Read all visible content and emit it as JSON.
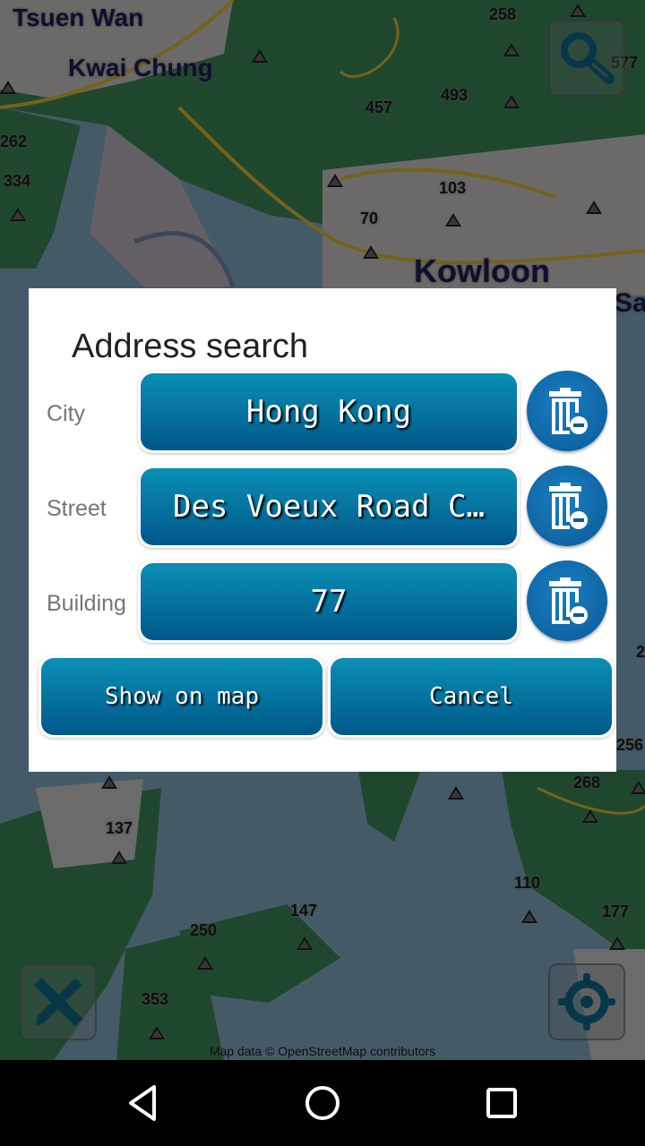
{
  "map": {
    "place_labels": [
      {
        "text": "Tsuen Wan",
        "id": "tsuen-wan"
      },
      {
        "text": "Kwai Chung",
        "id": "kwai-chung"
      },
      {
        "text": "Kowloon",
        "id": "kowloon"
      },
      {
        "text": "Sa",
        "id": "sa-partial"
      }
    ],
    "elevation_labels": [
      "258",
      "493",
      "457",
      "577",
      "262",
      "334",
      "103",
      "70",
      "137",
      "147",
      "250",
      "353",
      "268",
      "110",
      "177",
      "256",
      "2"
    ],
    "attribution": "Map data © OpenStreetMap contributors",
    "buttons": {
      "search": {
        "icon": "magnifier-icon"
      },
      "measure": {
        "icon": "ruler-pencil-icon"
      },
      "locate": {
        "icon": "crosshair-location-icon"
      }
    }
  },
  "dialog": {
    "title": "Address search",
    "fields": [
      {
        "label": "City",
        "value": "Hong Kong",
        "clear_icon": "trash-minus-icon"
      },
      {
        "label": "Street",
        "value": "Des Voeux Road C…",
        "clear_icon": "trash-minus-icon"
      },
      {
        "label": "Building",
        "value": "77",
        "clear_icon": "trash-minus-icon"
      }
    ],
    "actions": {
      "show_on_map": "Show on map",
      "cancel": "Cancel"
    }
  },
  "navbar": {
    "back": "back-icon",
    "home": "home-icon",
    "recents": "recents-icon"
  },
  "colors": {
    "button_top": "#0a8fb5",
    "button_bottom": "#00588a",
    "trash_button": "#1570b0",
    "map_forest": "#2e6b45",
    "map_water": "#4a5a6a"
  }
}
